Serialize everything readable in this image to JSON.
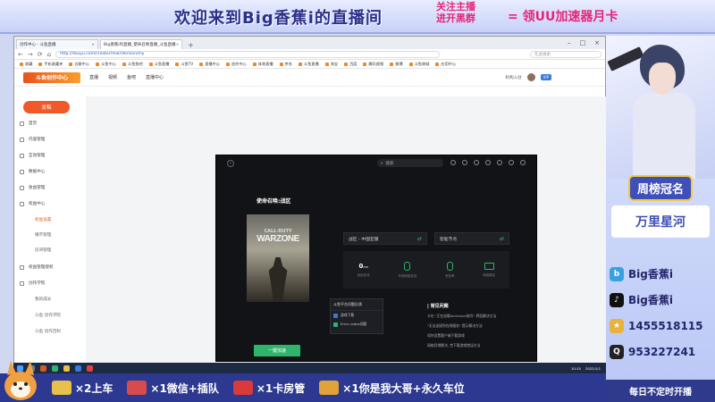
{
  "stream": {
    "banner_title": "欢迎来到Big香蕉i的直播间",
    "promo_line1": "关注主播",
    "promo_line2": "进开黑群",
    "promo_offer": "领UU加速器月卡",
    "weekly_top": "周榜冠名",
    "weekly_name": "万里星河",
    "contacts": [
      {
        "icon": "bilibili-icon",
        "text": "Big香蕉i",
        "color": "#3aa1e0"
      },
      {
        "icon": "douyin-icon",
        "text": "Big香蕉i",
        "color": "#111111"
      },
      {
        "icon": "group-icon",
        "text": "1455518115",
        "color": "#e7b33a"
      },
      {
        "icon": "qq-icon",
        "text": "953227241",
        "color": "#222222"
      }
    ],
    "schedule": "每日不定时开播",
    "bottom_items": [
      {
        "icon": "gold-bar-icon",
        "text": "×2上车",
        "color": "#e8c04a"
      },
      {
        "icon": "plane-icon",
        "text": "×1微信+插队",
        "color": "#d94a4a"
      },
      {
        "icon": "rocket-icon",
        "text": "×1卡房管",
        "color": "#d93a3a"
      },
      {
        "icon": "star-plane-icon",
        "text": "×1你是我大哥+永久车位",
        "color": "#e0a33a"
      }
    ]
  },
  "browser": {
    "tabs": [
      {
        "label": "创作中心 - 斗鱼直播",
        "active": false
      },
      {
        "label": "Big香蕉i的直播_使命召唤直播_斗鱼直播",
        "active": true
      }
    ],
    "url": "http://douyu.com/creator/mainVersion/my",
    "search_placeholder": "在此搜索",
    "bookmarks": [
      "收藏",
      "手机收藏夹",
      "谷歌中心",
      "斗鱼中心",
      "斗鱼鱼吧",
      "斗鱼直播",
      "斗鱼TV",
      "直播中心",
      "创作中心",
      "体育直播",
      "京东",
      "斗鱼直播",
      "淘宝",
      "百度",
      "腾讯视频",
      "微博",
      "斗鱼商城",
      "应用中心"
    ]
  },
  "site": {
    "logo": "斗鱼创作中心",
    "nav": [
      "直播",
      "视频",
      "鱼吧",
      "直播中心"
    ],
    "user": "机构入驻",
    "vip": "VIP"
  },
  "sidebar": {
    "publish": "发稿",
    "items": [
      {
        "label": "首页",
        "sub": false,
        "active": false
      },
      {
        "label": "内容管理",
        "sub": false,
        "active": false
      },
      {
        "label": "互动管理",
        "sub": false,
        "active": false
      },
      {
        "label": "数据中心",
        "sub": false,
        "active": false
      },
      {
        "label": "收益管理",
        "sub": false,
        "active": false
      },
      {
        "label": "权益中心",
        "sub": false,
        "active": false
      },
      {
        "label": "权益设置",
        "sub": true,
        "active": true
      },
      {
        "label": "播币管理",
        "sub": true,
        "active": false
      },
      {
        "label": "房间管理",
        "sub": true,
        "active": false
      },
      {
        "label": "权益管理授权",
        "sub": false,
        "active": false
      },
      {
        "label": "创作学院",
        "sub": false,
        "active": false
      },
      {
        "label": "我的成长",
        "sub": true,
        "active": false
      },
      {
        "label": "斗鱼 创作学院",
        "sub": true,
        "active": false
      },
      {
        "label": "斗鱼 创作百科",
        "sub": true,
        "active": false
      }
    ]
  },
  "app": {
    "search": "搜索",
    "game_title": "使命召唤:战区",
    "cover_top": "CALL·DUTY",
    "cover_main": "WARZONE",
    "region": "战区 - 中国亚服",
    "node": "智能节点",
    "stats": [
      {
        "value": "0",
        "unit": "ms",
        "label": "延迟优化",
        "icon": ""
      },
      {
        "value": "",
        "unit": "",
        "label": "本地网络延迟",
        "icon": "phone-icon"
      },
      {
        "value": "",
        "unit": "",
        "label": "丢包率",
        "icon": "phone-icon"
      },
      {
        "value": "",
        "unit": "",
        "label": "网络稳定",
        "icon": "monitor-icon"
      }
    ],
    "popup_title": "斗鱼平台问题反馈",
    "popup_items": [
      "游戏下载",
      "Error codes问题"
    ],
    "faq_title": "常见问题",
    "faq_items": [
      "卡在 \"正在加载Activision账号\" 界面解决方法",
      "\"无法连接到在线服务\" 提示解决方法",
      "如何设置客户端下载游戏",
      "网络异常解决, 完下载游戏错误方法"
    ],
    "play": "一键加速"
  },
  "taskbar": {
    "time": "10:15",
    "date": "2022/1/1"
  }
}
